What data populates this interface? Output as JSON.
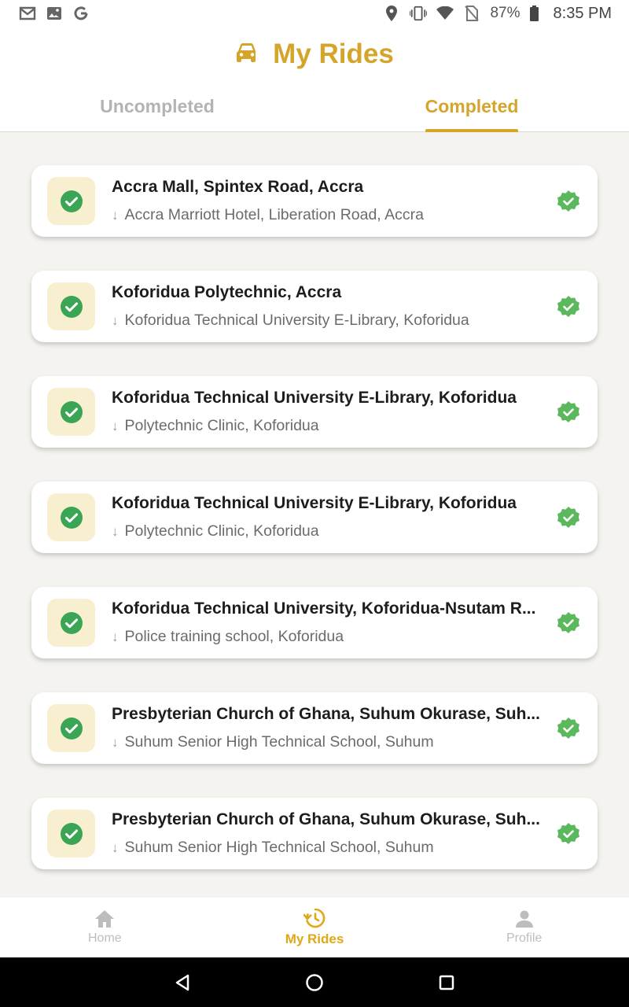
{
  "status_bar": {
    "battery": "87%",
    "time": "8:35 PM"
  },
  "header": {
    "title": "My Rides",
    "icon": "car-icon"
  },
  "tabs": [
    {
      "label": "Uncompleted",
      "active": false
    },
    {
      "label": "Completed",
      "active": true
    }
  ],
  "rides": [
    {
      "from": "Accra Mall, Spintex Road, Accra",
      "to": "Accra Marriott Hotel, Liberation Road, Accra"
    },
    {
      "from": "Koforidua Polytechnic, Accra",
      "to": "Koforidua Technical University E-Library, Koforidua"
    },
    {
      "from": "Koforidua Technical University E-Library, Koforidua",
      "to": "Polytechnic Clinic, Koforidua"
    },
    {
      "from": "Koforidua Technical University E-Library, Koforidua",
      "to": "Polytechnic Clinic, Koforidua"
    },
    {
      "from": "Koforidua Technical University, Koforidua-Nsutam R...",
      "to": "Police training school, Koforidua"
    },
    {
      "from": "Presbyterian Church of Ghana, Suhum Okurase, Suh...",
      "to": "Suhum Senior High Technical School, Suhum"
    },
    {
      "from": "Presbyterian Church of Ghana, Suhum Okurase, Suh...",
      "to": "Suhum Senior High Technical School, Suhum"
    }
  ],
  "bottom_nav": [
    {
      "label": "Home",
      "icon": "home-icon",
      "active": false
    },
    {
      "label": "My Rides",
      "icon": "history-icon",
      "active": true
    },
    {
      "label": "Profile",
      "icon": "person-icon",
      "active": false
    }
  ],
  "colors": {
    "accent": "#d4a52a",
    "success": "#3aa655",
    "verified": "#5cb85c"
  }
}
